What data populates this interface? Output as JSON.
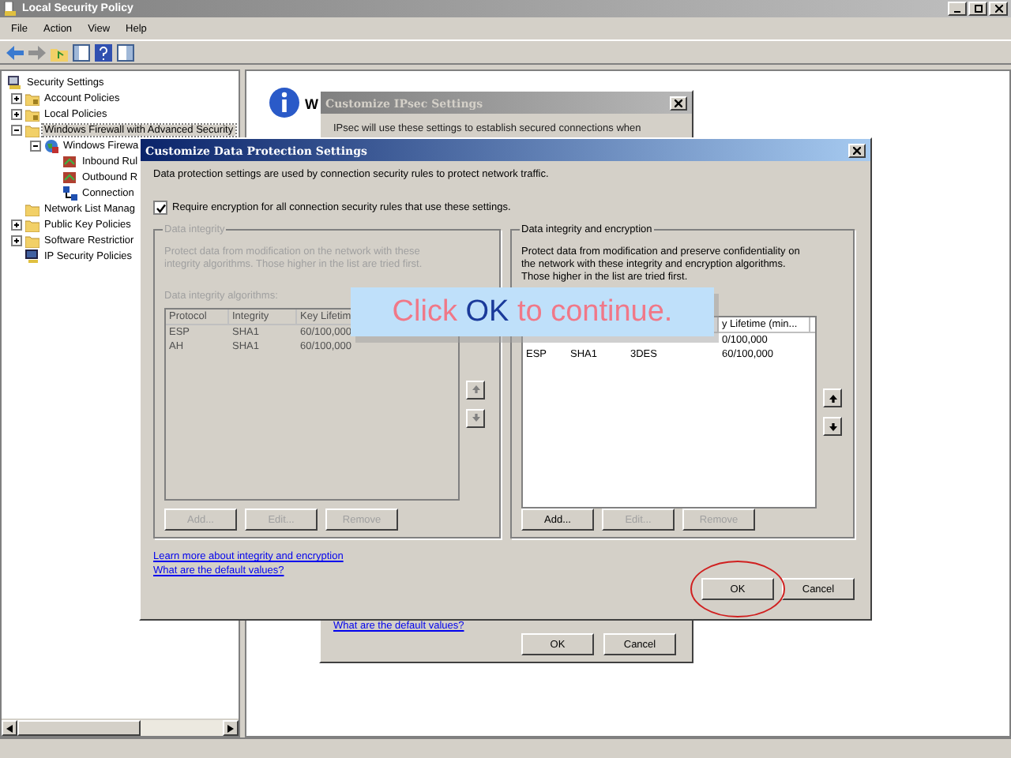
{
  "window": {
    "title": "Local Security Policy"
  },
  "menu": [
    "File",
    "Action",
    "View",
    "Help"
  ],
  "tree": [
    {
      "label": "Security Settings",
      "kind": "root",
      "selected": false,
      "children": [
        {
          "label": "Account Policies",
          "kind": "lockfolder",
          "expanded": false,
          "selected": false
        },
        {
          "label": "Local Policies",
          "kind": "lockfolder",
          "expanded": false,
          "selected": false
        },
        {
          "label": "Windows Firewall with Advanced Security",
          "kind": "folder",
          "expanded": true,
          "selected": true,
          "children": [
            {
              "label": "Windows Firewa",
              "kind": "globe",
              "expanded": true,
              "selected": false,
              "children": [
                {
                  "label": "Inbound Rul",
                  "kind": "rule",
                  "selected": false
                },
                {
                  "label": "Outbound R",
                  "kind": "rule",
                  "selected": false
                },
                {
                  "label": "Connection",
                  "kind": "link",
                  "selected": false
                }
              ]
            }
          ]
        },
        {
          "label": "Network List Manag",
          "kind": "folder",
          "selected": false
        },
        {
          "label": "Public Key Policies",
          "kind": "folder",
          "expanded": false,
          "selected": false
        },
        {
          "label": "Software Restrictior",
          "kind": "folder",
          "expanded": false,
          "selected": false
        },
        {
          "label": "IP Security Policies",
          "kind": "computer",
          "selected": false
        }
      ]
    }
  ],
  "details": {
    "heading": "W"
  },
  "ipsec_dialog": {
    "title": "Customize IPsec Settings",
    "text": "IPsec will use these settings to establish secured connections when",
    "link": "What are the default values?",
    "buttons": [
      "OK",
      "Cancel"
    ]
  },
  "protection_dialog": {
    "title": "Customize Data Protection Settings",
    "description": "Data protection settings are used by connection security rules to protect network traffic.",
    "require_encryption": {
      "label": "Require encryption for all connection security rules that use these settings.",
      "checked": true
    },
    "groups": [
      {
        "title": "Data integrity",
        "disabled": true,
        "description": "Protect data from modification on the network with these integrity algorithms. Those higher in the list are tried first.",
        "list_label": "Data integrity algorithms:",
        "columns": [
          {
            "label": "Protocol"
          },
          {
            "label": "Integrity"
          },
          {
            "label": "Key Lifetim"
          }
        ],
        "rows": [
          {
            "cells": [
              {
                "text": "ESP"
              },
              {
                "text": "SHA1"
              },
              {
                "text": "60/100,000"
              }
            ]
          },
          {
            "cells": [
              {
                "text": "AH"
              },
              {
                "text": "SHA1"
              },
              {
                "text": "60/100,000"
              }
            ]
          }
        ],
        "buttons": [
          "Add...",
          "Edit...",
          "Remove"
        ]
      },
      {
        "title": "Data integrity and encryption",
        "disabled": false,
        "description": "Protect data from modification and preserve confidentiality on the network with these integrity and encryption algorithms. Those higher in the list are tried first.",
        "columns": [
          {},
          {},
          {},
          {
            "label": "y Lifetime (min..."
          }
        ],
        "rows": [
          {
            "cells": [
              {},
              {},
              {},
              {
                "text": "0/100,000"
              }
            ]
          },
          {
            "cells": [
              {
                "text": "ESP"
              },
              {
                "text": "SHA1"
              },
              {
                "text": "3DES"
              },
              {
                "text": "60/100,000"
              }
            ]
          }
        ],
        "buttons": [
          "Add...",
          "Edit...",
          "Remove"
        ]
      }
    ],
    "links": [
      "Learn more about integrity and encryption",
      "What are the default values?"
    ],
    "buttons": [
      "OK",
      "Cancel"
    ]
  },
  "banner": {
    "before": "Click",
    "highlight": "OK",
    "after": "to continue."
  }
}
